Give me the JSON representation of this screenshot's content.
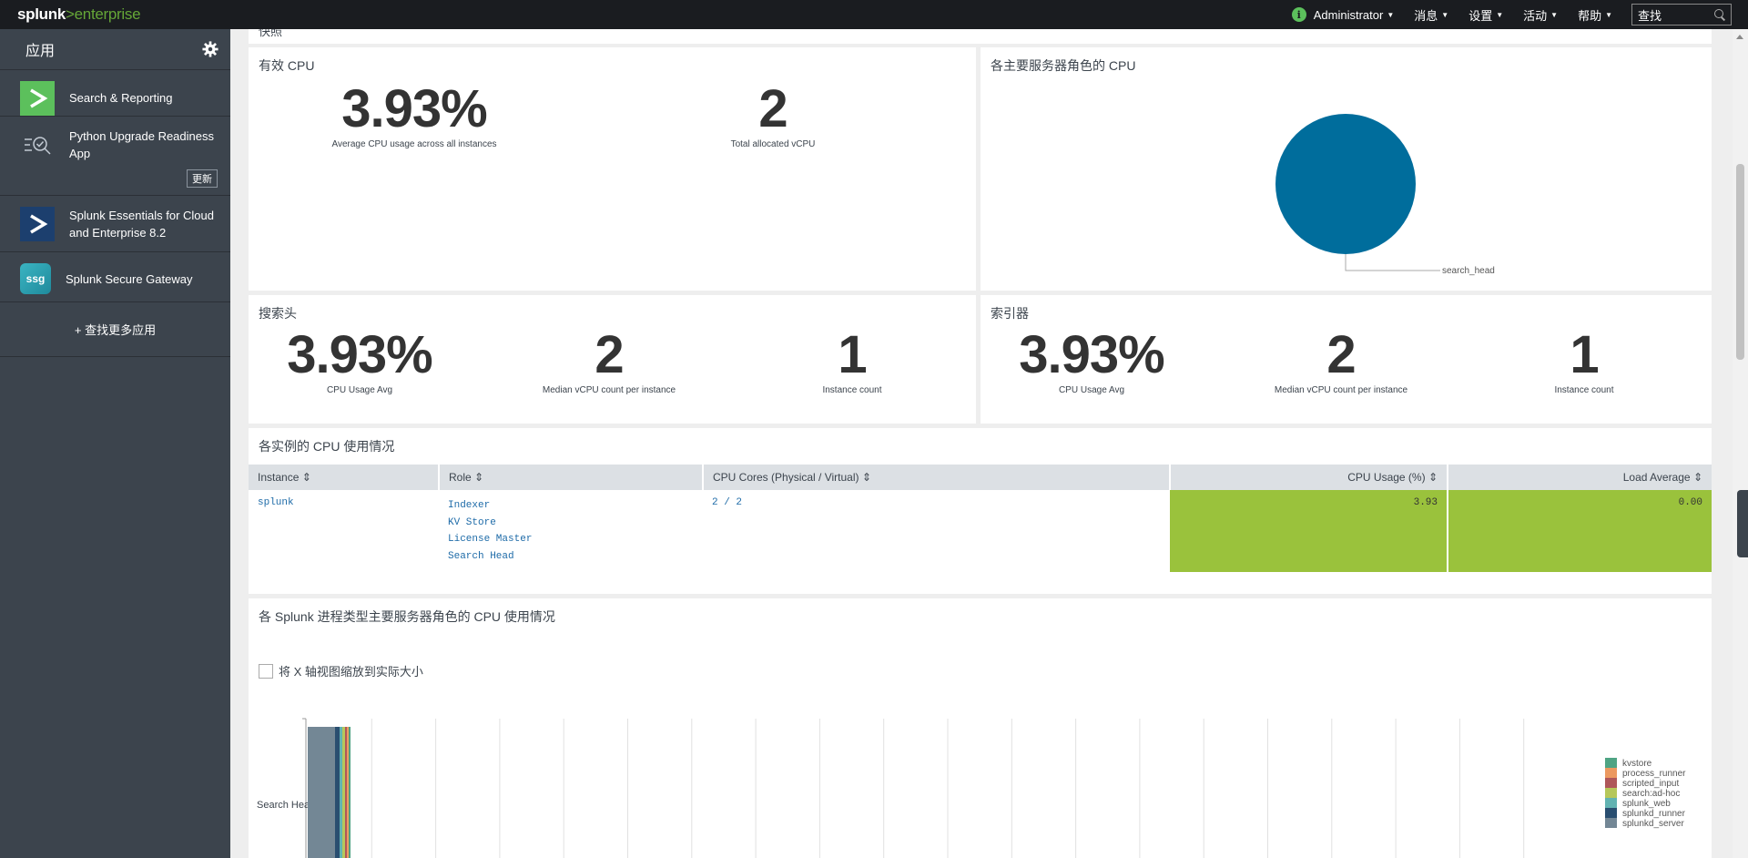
{
  "topbar": {
    "logo_main": "splunk",
    "logo_sep": ">",
    "logo_sub": "enterprise",
    "nav": [
      {
        "label": "Administrator"
      },
      {
        "label": "消息"
      },
      {
        "label": "设置"
      },
      {
        "label": "活动"
      },
      {
        "label": "帮助"
      }
    ],
    "search_value": "查找"
  },
  "sidebar": {
    "title": "应用",
    "apps": [
      {
        "label": "Search & Reporting",
        "icon": "search-reporting-icon",
        "color": "#5cc05c"
      },
      {
        "label": "Python Upgrade Readiness App",
        "icon": "python-readiness-icon",
        "update": "更新"
      },
      {
        "label": "Splunk Essentials for Cloud and Enterprise 8.2",
        "icon": "splunk-essentials-icon",
        "color": "#1c3f6e"
      },
      {
        "label": "Splunk Secure Gateway",
        "icon": "ssg-icon",
        "icon_text": "ssg",
        "color": "#2aa6a6"
      }
    ],
    "more_apps": "+ 查找更多应用"
  },
  "panels": {
    "top_cut_text": "快照",
    "effective_cpu": {
      "title": "有效 CPU",
      "values": [
        {
          "value": "3.93%",
          "label": "Average CPU usage across all instances"
        },
        {
          "value": "2",
          "label": "Total allocated vCPU"
        }
      ]
    },
    "role_cpu": {
      "title": "各主要服务器角色的 CPU",
      "pie_label": "search_head",
      "pie_color": "#006d9c"
    },
    "search_head": {
      "title": "搜索头",
      "values": [
        {
          "value": "3.93%",
          "label": "CPU Usage Avg"
        },
        {
          "value": "2",
          "label": "Median vCPU count per instance"
        },
        {
          "value": "1",
          "label": "Instance count"
        }
      ]
    },
    "indexer": {
      "title": "索引器",
      "values": [
        {
          "value": "3.93%",
          "label": "CPU Usage Avg"
        },
        {
          "value": "2",
          "label": "Median vCPU count per instance"
        },
        {
          "value": "1",
          "label": "Instance count"
        }
      ]
    },
    "instances": {
      "title": "各实例的 CPU 使用情况",
      "columns": [
        "Instance",
        "Role",
        "CPU Cores (Physical / Virtual)",
        "CPU Usage (%)",
        "Load Average"
      ],
      "rows": [
        {
          "instance": "splunk",
          "roles": [
            "Indexer",
            "KV Store",
            "License Master",
            "Search Head"
          ],
          "cores": "2 / 2",
          "usage": "3.93",
          "load": "0.00"
        }
      ],
      "highlight_color": "#9ac23c"
    },
    "process_cpu": {
      "title": "各 Splunk 进程类型主要服务器角色的 CPU 使用情况",
      "checkbox_label": "将 X 轴视图缩放到实际大小"
    }
  },
  "chart_data": {
    "type": "bar",
    "orientation": "horizontal",
    "stacked": true,
    "categories": [
      "Search Head"
    ],
    "series": [
      {
        "name": "kvstore",
        "color": "#4fa484",
        "values": [
          0.02
        ]
      },
      {
        "name": "process_runner",
        "color": "#ec9960",
        "values": [
          0.02
        ]
      },
      {
        "name": "scripted_input",
        "color": "#af575a",
        "values": [
          0.02
        ]
      },
      {
        "name": "search:ad-hoc",
        "color": "#b6c75a",
        "values": [
          0.03
        ]
      },
      {
        "name": "splunk_web",
        "color": "#62b3b2",
        "values": [
          0.03
        ]
      },
      {
        "name": "splunkd_runner",
        "color": "#294e70",
        "values": [
          0.05
        ]
      },
      {
        "name": "splunkd_server",
        "color": "#738795",
        "values": [
          0.3
        ]
      }
    ],
    "legend_position": "right",
    "grid": true
  }
}
